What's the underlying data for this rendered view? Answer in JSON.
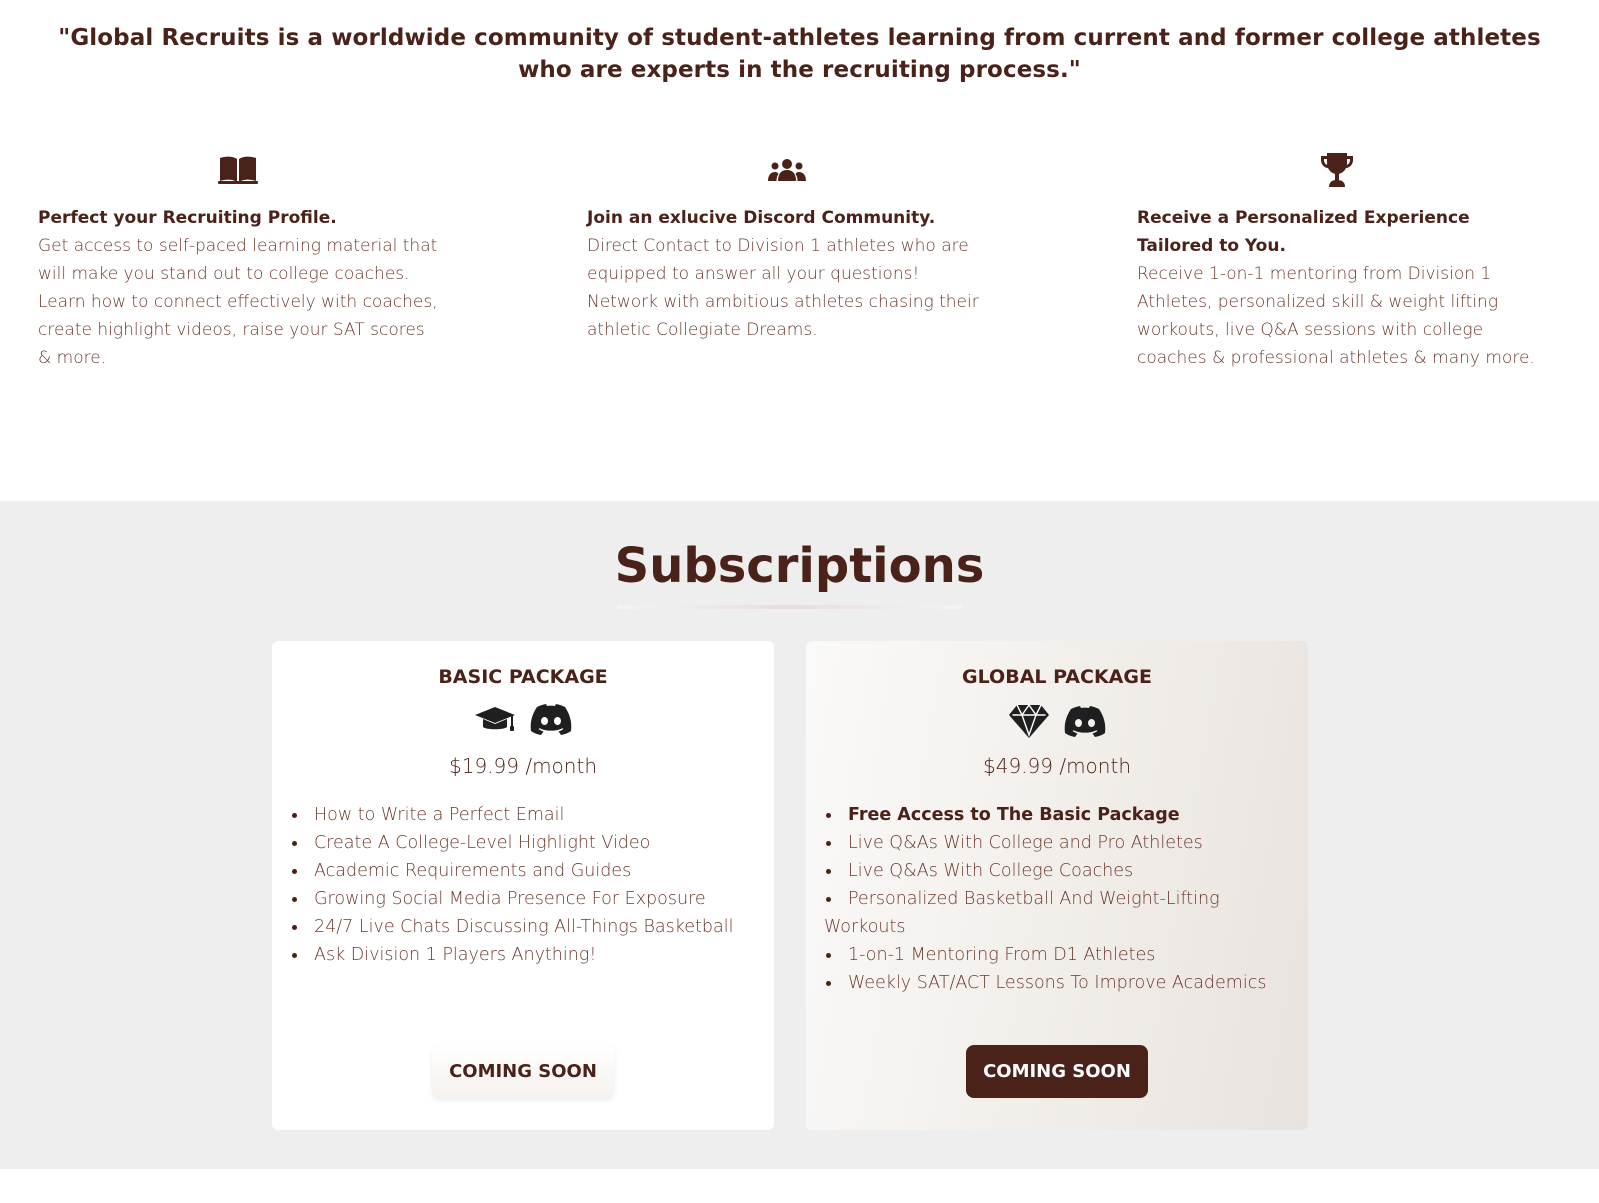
{
  "quote": "\"Global Recruits is a worldwide community of student-athletes learning from current and former college athletes who are experts in the recruiting process.\"",
  "features": [
    {
      "icon": "book-icon",
      "title": "Perfect your Recruiting Profile.",
      "body": "Get access to self-paced learning material that will make you stand out to college coaches. Learn how to connect effectively with coaches, create highlight videos, raise your SAT scores & more."
    },
    {
      "icon": "users-icon",
      "title": "Join an exlucive Discord Community.",
      "body": "Direct Contact to Division 1 athletes who are equipped to answer all your questions! Network with ambitious athletes chasing their athletic Collegiate Dreams."
    },
    {
      "icon": "trophy-icon",
      "title": "Receive a Personalized Experience Tailored to You.",
      "body": "Receive 1-on-1 mentoring from Division 1 Athletes, personalized skill & weight lifting workouts, live Q&A sessions with college coaches & professional athletes & many more."
    }
  ],
  "subscriptions": {
    "title": "Subscriptions",
    "basic": {
      "title": "BASIC PACKAGE",
      "icons": [
        "graduation-cap-icon",
        "discord-icon"
      ],
      "price": "$19.99 /month",
      "items": [
        "How to Write a Perfect Email",
        "Create A College-Level Highlight Video",
        "Academic Requirements and Guides",
        "Growing Social Media Presence For Exposure",
        "24/7 Live Chats Discussing All-Things Basketball",
        "Ask Division 1 Players Anything!"
      ],
      "button": "COMING SOON"
    },
    "global": {
      "title": "GLOBAL PACKAGE",
      "icons": [
        "diamond-icon",
        "discord-icon"
      ],
      "price": "$49.99 /month",
      "items": [
        "Free Access to The Basic Package",
        "Live Q&As With College and Pro Athletes",
        "Live Q&As With College Coaches",
        "Personalized Basketball And Weight-Lifting Workouts",
        "1-on-1 Mentoring From D1 Athletes",
        "Weekly SAT/ACT Lessons To Improve Academics"
      ],
      "button": "COMING SOON"
    }
  },
  "colors": {
    "brand": "#4a2219",
    "section_bg": "#efeeee"
  }
}
